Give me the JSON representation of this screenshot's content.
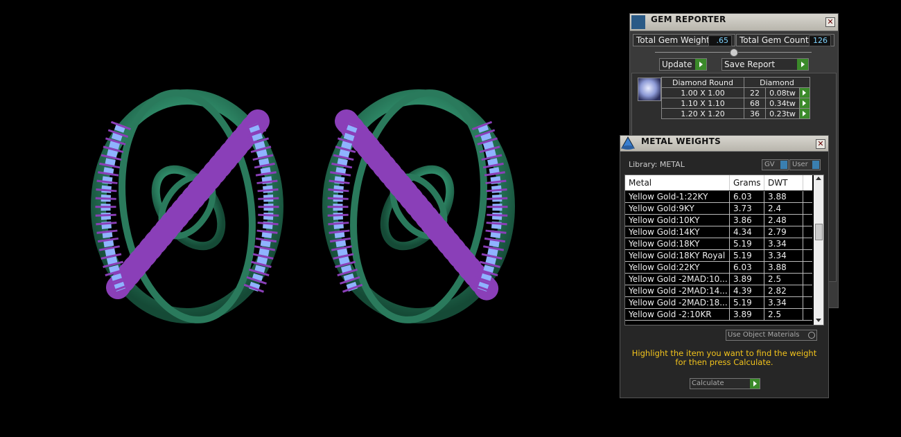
{
  "gem_reporter": {
    "title": "GEM REPORTER",
    "close": "✕",
    "total_weight_label": "Total Gem Weight",
    "total_weight_value": ".65",
    "total_count_label": "Total Gem Count",
    "total_count_value": "126",
    "update_label": "Update",
    "save_report_label": "Save Report",
    "table": {
      "shape_header": "Diamond Round",
      "material_header": "Diamond",
      "rows": [
        {
          "size": "1.00 X 1.00",
          "count": "22",
          "weight": "0.08tw"
        },
        {
          "size": "1.10 X 1.10",
          "count": "68",
          "weight": "0.34tw"
        },
        {
          "size": "1.20 X 1.20",
          "count": "36",
          "weight": "0.23tw"
        }
      ]
    }
  },
  "metal_weights": {
    "title": "METAL WEIGHTS",
    "close": "✕",
    "library_label": "Library: METAL",
    "gv_label": "GV",
    "user_label": "User",
    "columns": {
      "metal": "Metal",
      "grams": "Grams",
      "dwt": "DWT"
    },
    "rows": [
      {
        "metal": "Yellow Gold-1:22KY",
        "grams": "6.03",
        "dwt": "3.88"
      },
      {
        "metal": "Yellow Gold:9KY",
        "grams": "3.73",
        "dwt": "2.4"
      },
      {
        "metal": "Yellow Gold:10KY",
        "grams": "3.86",
        "dwt": "2.48"
      },
      {
        "metal": "Yellow Gold:14KY",
        "grams": "4.34",
        "dwt": "2.79"
      },
      {
        "metal": "Yellow Gold:18KY",
        "grams": "5.19",
        "dwt": "3.34"
      },
      {
        "metal": "Yellow Gold:18KY Royal",
        "grams": "5.19",
        "dwt": "3.34"
      },
      {
        "metal": "Yellow Gold:22KY",
        "grams": "6.03",
        "dwt": "3.88"
      },
      {
        "metal": "Yellow Gold -2MAD:10...",
        "grams": "3.89",
        "dwt": "2.5"
      },
      {
        "metal": "Yellow Gold -2MAD:14...",
        "grams": "4.39",
        "dwt": "2.82"
      },
      {
        "metal": "Yellow Gold -2MAD:18...",
        "grams": "5.19",
        "dwt": "3.34"
      },
      {
        "metal": "Yellow Gold -2:10KR",
        "grams": "3.89",
        "dwt": "2.5"
      }
    ],
    "use_object_materials_label": "Use Object Materials",
    "hint": "Highlight the item you want to find the weight for then press Calculate.",
    "calculate_label": "Calculate"
  },
  "colors": {
    "metal_green": "#2f8a68",
    "stone_blue": "#8fb3ff",
    "prong_purple": "#8a3fb8",
    "hint_yellow": "#f2c31c",
    "go_green": "#3b8a2a"
  }
}
